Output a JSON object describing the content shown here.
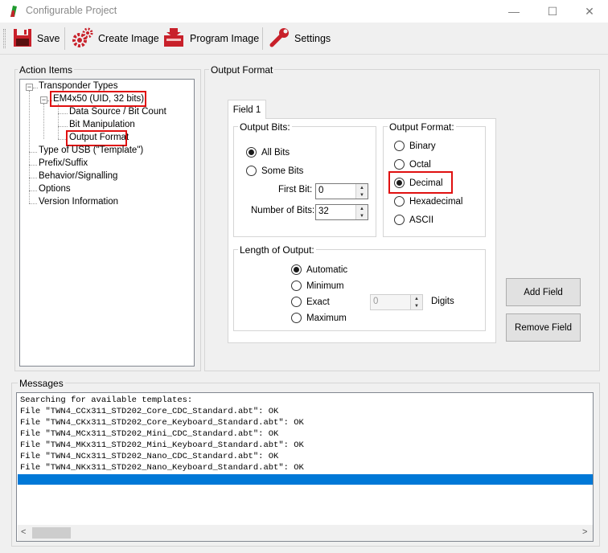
{
  "window": {
    "title": "Configurable Project",
    "controls": {
      "minimize": "—",
      "maximize": "☐",
      "close": "✕"
    }
  },
  "toolbar": {
    "save_label": "Save",
    "create_image_label": "Create Image",
    "program_image_label": "Program Image",
    "settings_label": "Settings"
  },
  "action_items": {
    "title": "Action Items",
    "tree": {
      "root": "Transponder Types",
      "selected_type": "EM4x50 (UID, 32 bits)",
      "children": [
        "Data Source / Bit Count",
        "Bit Manipulation",
        "Output Format"
      ],
      "others": [
        "Type of USB (\"Template\")",
        "Prefix/Suffix",
        "Behavior/Signalling",
        "Options",
        "Version Information"
      ]
    }
  },
  "output_format": {
    "title": "Output Format",
    "tab": "Field 1",
    "output_bits": {
      "title": "Output Bits:",
      "options": [
        "All Bits",
        "Some Bits"
      ],
      "selected": "All Bits",
      "first_bit_label": "First Bit:",
      "first_bit_value": "0",
      "num_bits_label": "Number of Bits:",
      "num_bits_value": "32"
    },
    "format": {
      "title": "Output Format:",
      "options": [
        "Binary",
        "Octal",
        "Decimal",
        "Hexadecimal",
        "ASCII"
      ],
      "selected": "Decimal"
    },
    "length": {
      "title": "Length of Output:",
      "options": [
        "Automatic",
        "Minimum",
        "Exact",
        "Maximum"
      ],
      "selected": "Automatic",
      "digits_value": "0",
      "digits_label": "Digits"
    },
    "add_field": "Add Field",
    "remove_field": "Remove Field"
  },
  "messages": {
    "title": "Messages",
    "lines": [
      "Searching for available templates:",
      "File \"TWN4_CCx311_STD202_Core_CDC_Standard.abt\": OK",
      "File \"TWN4_CKx311_STD202_Core_Keyboard_Standard.abt\": OK",
      "File \"TWN4_MCx311_STD202_Mini_CDC_Standard.abt\": OK",
      "File \"TWN4_MKx311_STD202_Mini_Keyboard_Standard.abt\": OK",
      "File \"TWN4_NCx311_STD202_Nano_CDC_Standard.abt\": OK",
      "File \"TWN4_NKx311_STD202_Nano_Keyboard_Standard.abt\": OK"
    ],
    "scroll_left": "<",
    "scroll_right": ">"
  },
  "colors": {
    "highlight": "#e01010",
    "selection": "#0078d7"
  }
}
